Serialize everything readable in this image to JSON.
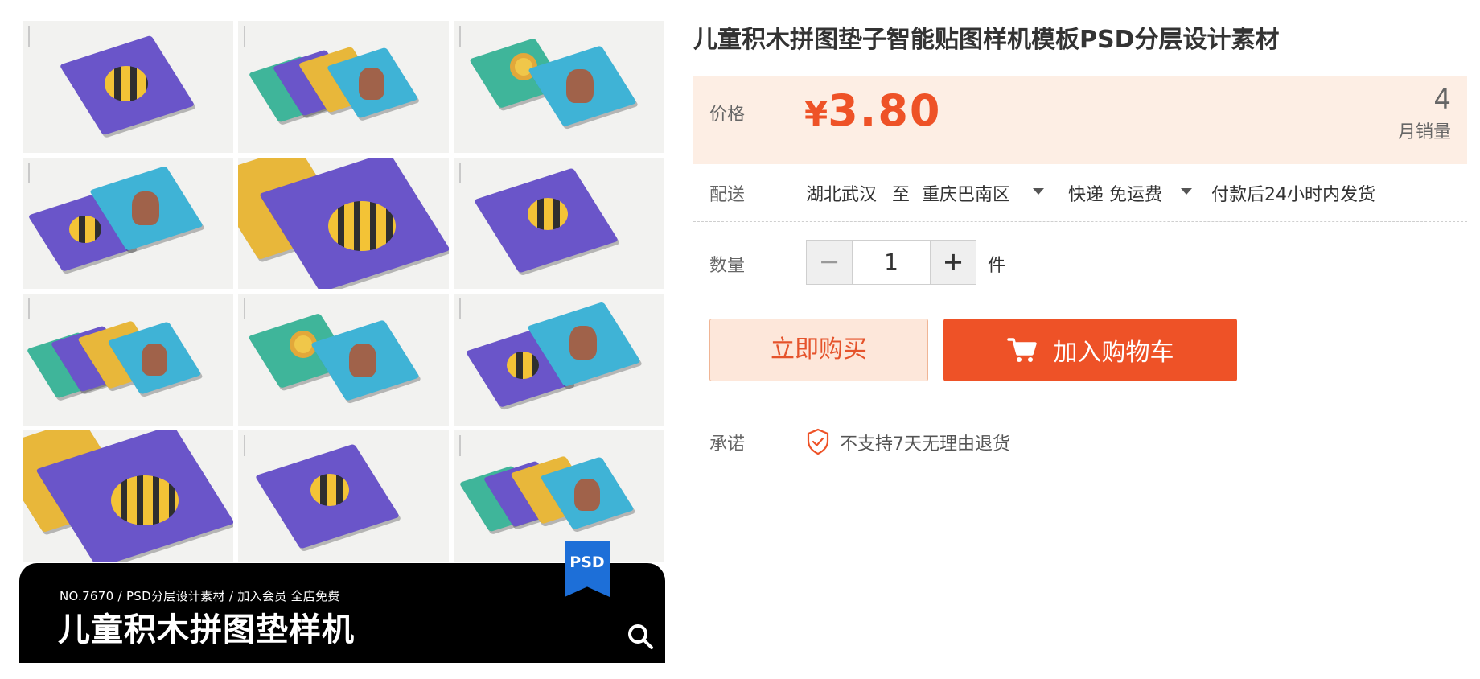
{
  "product": {
    "title": "儿童积木拼图垫子智能贴图样机模板PSD分层设计素材"
  },
  "gallery": {
    "banner_meta": "NO.7670 / PSD分层设计素材 / 加入会员 全店免费",
    "banner_title": "儿童积木拼图垫样机",
    "badge": "PSD",
    "zoom_icon": "search-icon"
  },
  "price": {
    "label": "价格",
    "currency": "¥",
    "amount": "3.80",
    "sales_count": "4",
    "sales_label": "月销量",
    "color": "#ee5227"
  },
  "shipping": {
    "label": "配送",
    "from": "湖北武汉",
    "to_word": "至",
    "destination": "重庆巴南区",
    "method": "快递 免运费",
    "dispatch": "付款后24小时内发货"
  },
  "quantity": {
    "label": "数量",
    "minus": "−",
    "value": "1",
    "plus": "+",
    "unit": "件"
  },
  "actions": {
    "buy_now": "立即购买",
    "add_to_cart": "加入购物车",
    "cart_icon": "cart-icon"
  },
  "promise": {
    "label": "承诺",
    "text": "不支持7天无理由退货",
    "icon": "shield-check-icon"
  }
}
